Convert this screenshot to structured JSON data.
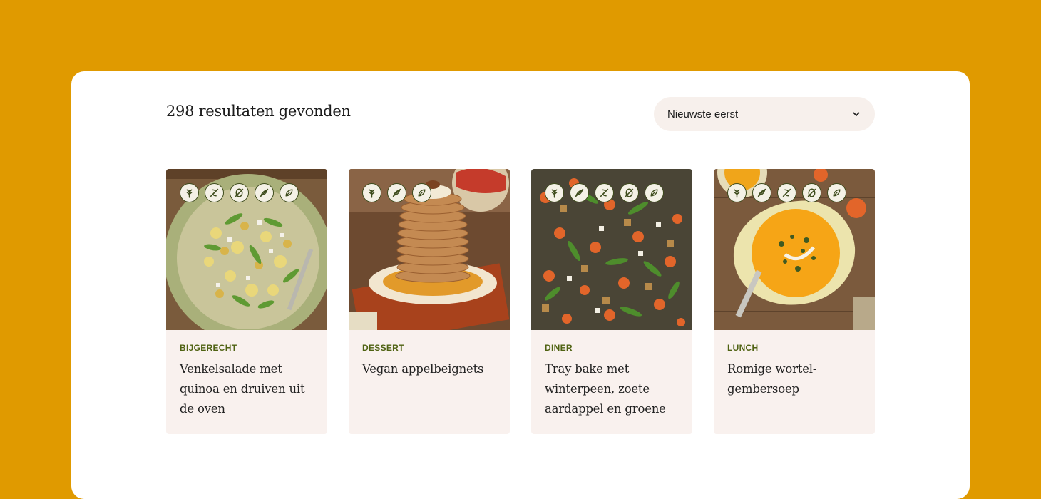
{
  "results_title": "298 resultaten gevonden",
  "sort": {
    "selected": "Nieuwste eerst",
    "icon": "chevron-down-icon"
  },
  "colors": {
    "background": "#e09a00",
    "panel": "#ffffff",
    "card": "#f9f1ee",
    "category": "#4f6212",
    "badge_ring": "#3e4c1d"
  },
  "recipes": [
    {
      "category": "BIJGERECHT",
      "title": "Venkelsalade met quinoa en druiven uit de oven",
      "badges": [
        "vegan-icon",
        "gluten-free-icon",
        "nut-free-icon",
        "soy-free-icon",
        "sugar-free-icon"
      ]
    },
    {
      "category": "DESSERT",
      "title": "Vegan appelbeignets",
      "badges": [
        "vegan-icon",
        "soy-free-icon",
        "sugar-free-icon"
      ]
    },
    {
      "category": "DINER",
      "title": "Tray bake met winterpeen, zoete aardappel en groene",
      "badges": [
        "vegan-icon",
        "soy-free-icon",
        "gluten-free-icon",
        "nut-free-icon",
        "sugar-free-icon"
      ]
    },
    {
      "category": "LUNCH",
      "title": "Romige wortel-gembersoep",
      "badges": [
        "vegan-icon",
        "soy-free-icon",
        "gluten-free-icon",
        "nut-free-icon",
        "sugar-free-icon"
      ]
    }
  ]
}
